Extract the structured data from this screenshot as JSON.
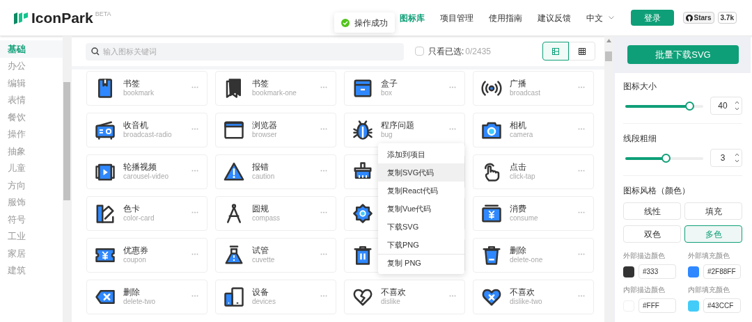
{
  "header": {
    "logo": "IconPark",
    "badge": "BETA",
    "nav": [
      {
        "label": "图标库",
        "selected": true
      },
      {
        "label": "项目管理",
        "selected": false
      },
      {
        "label": "使用指南",
        "selected": false
      },
      {
        "label": "建议反馈",
        "selected": false
      }
    ],
    "language": "中文",
    "login": "登录",
    "github": {
      "label": "Stars",
      "count": "3.7k"
    }
  },
  "toast": {
    "message": "操作成功"
  },
  "categories": [
    {
      "label": "基础",
      "selected": true
    },
    {
      "label": "办公",
      "selected": false
    },
    {
      "label": "编辑",
      "selected": false
    },
    {
      "label": "表情",
      "selected": false
    },
    {
      "label": "餐饮",
      "selected": false
    },
    {
      "label": "操作",
      "selected": false
    },
    {
      "label": "抽象",
      "selected": false
    },
    {
      "label": "儿童",
      "selected": false
    },
    {
      "label": "方向",
      "selected": false
    },
    {
      "label": "服饰",
      "selected": false
    },
    {
      "label": "符号",
      "selected": false
    },
    {
      "label": "工业",
      "selected": false
    },
    {
      "label": "家居",
      "selected": false
    },
    {
      "label": "建筑",
      "selected": false
    }
  ],
  "toolbar": {
    "search_placeholder": "输入图标关键词",
    "filter": {
      "label": "只看已选:",
      "count": "0/2435",
      "checked": false
    },
    "view_modes": [
      {
        "selected": true
      },
      {
        "selected": false
      }
    ]
  },
  "icons": [
    {
      "kind": "labeled",
      "name": "书签",
      "id": "bookmark"
    },
    {
      "kind": "labeled",
      "name": "书签",
      "id": "bookmark-one"
    },
    {
      "kind": "labeled",
      "name": "盒子",
      "id": "box"
    },
    {
      "kind": "labeled",
      "name": "广播",
      "id": "broadcast"
    },
    {
      "kind": "labeled",
      "name": "收音机",
      "id": "broadcast-radio"
    },
    {
      "kind": "labeled",
      "name": "浏览器",
      "id": "browser"
    },
    {
      "kind": "labeled",
      "name": "程序问题",
      "id": "bug"
    },
    {
      "kind": "labeled",
      "name": "相机",
      "id": "camera"
    },
    {
      "kind": "labeled",
      "name": "轮播视频",
      "id": "carousel-video"
    },
    {
      "kind": "labeled",
      "name": "报错",
      "id": "caution"
    },
    {
      "kind": "covered"
    },
    {
      "kind": "labeled",
      "name": "点击",
      "id": "click-tap"
    },
    {
      "kind": "labeled",
      "name": "色卡",
      "id": "color-card"
    },
    {
      "kind": "labeled",
      "name": "圆规",
      "id": "compass"
    },
    {
      "kind": "covered"
    },
    {
      "kind": "labeled",
      "name": "消费",
      "id": "consume"
    },
    {
      "kind": "labeled",
      "name": "优惠券",
      "id": "coupon"
    },
    {
      "kind": "labeled",
      "name": "试管",
      "id": "cuvette"
    },
    {
      "kind": "covered"
    },
    {
      "kind": "labeled",
      "name": "删除",
      "id": "delete-one"
    },
    {
      "kind": "labeled",
      "name": "删除",
      "id": "delete-two"
    },
    {
      "kind": "labeled",
      "name": "设备",
      "id": "devices"
    },
    {
      "kind": "labeled",
      "name": "不喜欢",
      "id": "dislike"
    },
    {
      "kind": "labeled",
      "name": "不喜欢",
      "id": "dislike-two"
    }
  ],
  "context_menu": {
    "items": [
      {
        "label": "添加到项目",
        "hovered": false,
        "divider_before": false
      },
      {
        "label": "复制SVG代码",
        "hovered": true,
        "divider_before": false
      },
      {
        "label": "复制React代码",
        "hovered": false,
        "divider_before": false
      },
      {
        "label": "复制Vue代码",
        "hovered": false,
        "divider_before": false
      },
      {
        "label": "下载SVG",
        "hovered": false,
        "divider_before": false
      },
      {
        "label": "下载PNG",
        "hovered": false,
        "divider_before": false
      },
      {
        "label": "复制 PNG",
        "hovered": false,
        "divider_before": true
      }
    ]
  },
  "panel": {
    "download": "批量下载SVG",
    "sliders": [
      {
        "label": "图标大小",
        "level": 0.82,
        "value": "40"
      },
      {
        "label": "线段粗细",
        "level": 0.52,
        "value": "3"
      }
    ],
    "style": {
      "label": "图标风格（颜色）",
      "options": [
        {
          "label": "线性",
          "selected": false
        },
        {
          "label": "填充",
          "selected": false
        },
        {
          "label": "双色",
          "selected": false
        },
        {
          "label": "多色",
          "selected": true
        }
      ]
    },
    "colors": [
      {
        "label": "外部描边颜色",
        "color": "#333333",
        "value": "#333"
      },
      {
        "label": "外部填充颜色",
        "color": "#2f88ff",
        "value": "#2F88FF"
      },
      {
        "label": "内部描边颜色",
        "color": "#ffffff",
        "value": "#FFF"
      },
      {
        "label": "内部填充颜色",
        "color": "#43ccf8",
        "value": "#43CCF"
      }
    ]
  }
}
